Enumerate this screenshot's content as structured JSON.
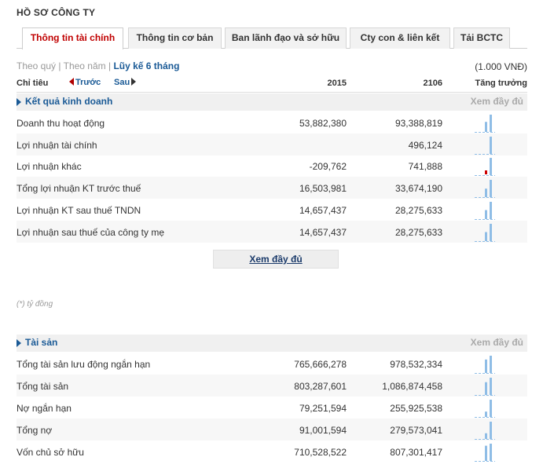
{
  "page_title": "HỒ SƠ CÔNG TY",
  "tabs": [
    {
      "label": "Thông tin tài chính",
      "active": true
    },
    {
      "label": "Thông tin cơ bản",
      "active": false
    },
    {
      "label": "Ban lãnh đạo và sở hữu",
      "active": false
    },
    {
      "label": "Cty con & liên kết",
      "active": false
    },
    {
      "label": "Tải BCTC",
      "active": false
    }
  ],
  "period_nav": {
    "quarter": "Theo quý",
    "sep1": " | ",
    "year": "Theo năm",
    "sep2": " | ",
    "cumulative": "Lũy kế 6 tháng"
  },
  "unit_note": "(1.000 VNĐ)",
  "column_header": {
    "indicator": "Chỉ tiêu",
    "prev": "Trước",
    "next": "Sau",
    "year1": "2015",
    "year2": "2106",
    "growth": "Tăng trưởng"
  },
  "see_more_label": "Xem đầy đủ",
  "footnote": "(*) tỷ đồng",
  "sections": [
    {
      "title": "Kết quả kinh doanh",
      "more": "Xem đầy đủ",
      "rows": [
        {
          "name": "Doanh thu hoạt động",
          "v1": "53,882,380",
          "v2": "93,388,819",
          "bars": [
            0.58,
            1.0
          ],
          "neg": [
            false,
            false
          ]
        },
        {
          "name": "Lợi nhuận tài chính",
          "v1": "",
          "v2": "496,124",
          "bars": [
            0,
            1.0
          ],
          "neg": [
            false,
            false
          ]
        },
        {
          "name": "Lợi nhuận khác",
          "v1": "-209,762",
          "v2": "741,888",
          "bars": [
            0.28,
            1.0
          ],
          "neg": [
            true,
            false
          ]
        },
        {
          "name": "Tổng lợi nhuận KT trước thuế",
          "v1": "16,503,981",
          "v2": "33,674,190",
          "bars": [
            0.49,
            1.0
          ],
          "neg": [
            false,
            false
          ]
        },
        {
          "name": "Lợi nhuận KT sau thuế TNDN",
          "v1": "14,657,437",
          "v2": "28,275,633",
          "bars": [
            0.52,
            1.0
          ],
          "neg": [
            false,
            false
          ]
        },
        {
          "name": "Lợi nhuận sau thuế của công ty mẹ",
          "v1": "14,657,437",
          "v2": "28,275,633",
          "bars": [
            0.52,
            1.0
          ],
          "neg": [
            false,
            false
          ]
        }
      ]
    },
    {
      "title": "Tài sản",
      "more": "Xem đầy đủ",
      "rows": [
        {
          "name": "Tổng tài sản lưu động ngắn hạn",
          "v1": "765,666,278",
          "v2": "978,532,334",
          "bars": [
            0.78,
            1.0
          ],
          "neg": [
            false,
            false
          ]
        },
        {
          "name": "Tổng tài sản",
          "v1": "803,287,601",
          "v2": "1,086,874,458",
          "bars": [
            0.74,
            1.0
          ],
          "neg": [
            false,
            false
          ]
        },
        {
          "name": "Nợ ngắn hạn",
          "v1": "79,251,594",
          "v2": "255,925,538",
          "bars": [
            0.31,
            1.0
          ],
          "neg": [
            false,
            false
          ]
        },
        {
          "name": "Tổng nợ",
          "v1": "91,001,594",
          "v2": "279,573,041",
          "bars": [
            0.33,
            1.0
          ],
          "neg": [
            false,
            false
          ]
        },
        {
          "name": "Vốn chủ sở hữu",
          "v1": "710,528,522",
          "v2": "807,301,417",
          "bars": [
            0.88,
            1.0
          ],
          "neg": [
            false,
            false
          ]
        }
      ]
    }
  ],
  "colors": {
    "accent": "#1a5a96",
    "active_tab": "#c00000",
    "bar": "#8fbde6",
    "bar_negative": "#cc0000"
  }
}
